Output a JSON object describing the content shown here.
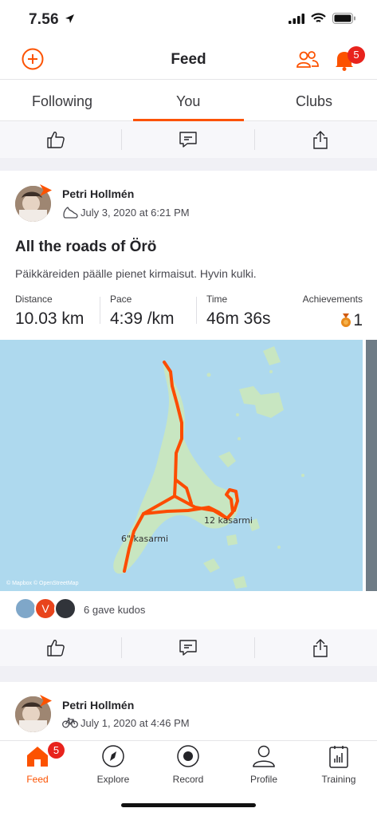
{
  "status": {
    "time": "7.56"
  },
  "header": {
    "title": "Feed",
    "notification_count": "5",
    "icons": [
      "add-icon",
      "friends-icon",
      "bell-icon"
    ]
  },
  "tabs": [
    {
      "label": "Following",
      "active": false
    },
    {
      "label": "You",
      "active": true
    },
    {
      "label": "Clubs",
      "active": false
    }
  ],
  "actions": {
    "icons": [
      "thumbs-up-icon",
      "comment-icon",
      "share-icon"
    ]
  },
  "activity": {
    "athlete": "Petri Hollmén",
    "date": "July 3, 2020 at 6:21 PM",
    "sport_icon": "run-shoe-icon",
    "title": "All the roads of Örö",
    "description": "Päikkäreiden päälle pienet kirmaisut. Hyvin kulki.",
    "stats": [
      {
        "label": "Distance",
        "value": "10.03 km"
      },
      {
        "label": "Pace",
        "value": "4:39 /km"
      },
      {
        "label": "Time",
        "value": "46m 36s"
      }
    ],
    "achievements": {
      "label": "Achievements",
      "value": "1"
    },
    "map": {
      "labels": [
        "6\" kasarmi",
        "12 kasarmi"
      ],
      "credit": "© Mapbox © OpenStreetMap"
    },
    "kudos": {
      "initial": "V",
      "text": "6 gave kudos"
    }
  },
  "next_activity": {
    "athlete": "Petri Hollmén",
    "date": "July 1, 2020 at 4:46 PM",
    "sport_icon": "bike-icon"
  },
  "tab_bar": {
    "items": [
      {
        "label": "Feed",
        "active": true
      },
      {
        "label": "Explore",
        "active": false
      },
      {
        "label": "Record",
        "active": false
      },
      {
        "label": "Profile",
        "active": false
      },
      {
        "label": "Training",
        "active": false
      }
    ],
    "feed_badge": "5"
  },
  "colors": {
    "accent": "#fc5200",
    "badge": "#e8231d",
    "water": "#aed9ee",
    "land": "#c8e6c1",
    "route": "#fc4c02"
  }
}
